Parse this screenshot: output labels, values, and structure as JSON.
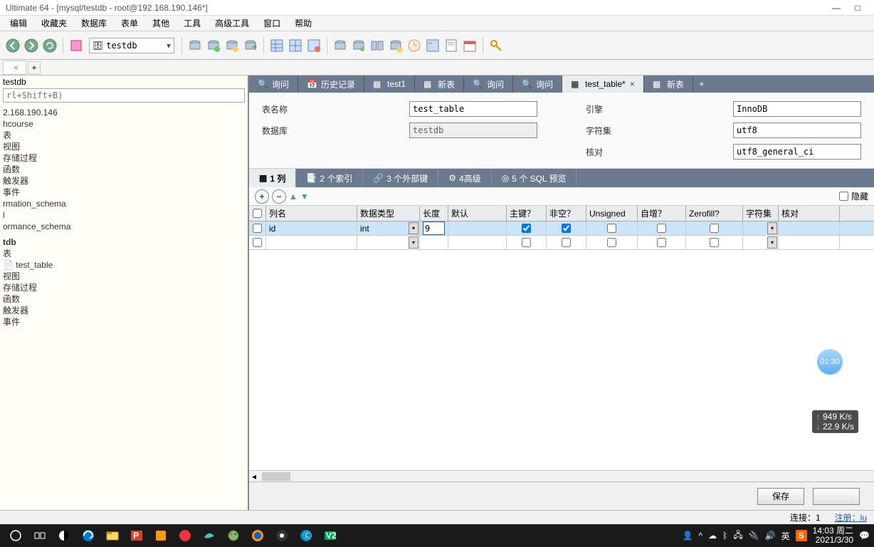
{
  "window": {
    "title": "Ultimate 64 - [mysql/testdb - root@192.168.190.146*]"
  },
  "menu": [
    "编辑",
    "收藏夹",
    "数据库",
    "表单",
    "其他",
    "工具",
    "高级工具",
    "窗口",
    "帮助"
  ],
  "conn_tab": {
    "label": "",
    "close": "×",
    "add": "+"
  },
  "db_selector": "testdb",
  "sidebar": {
    "root": "testdb",
    "filter_placeholder": "rl+Shift+B)",
    "nodes": [
      "2.168.190.146",
      "hcourse",
      "表",
      "视图",
      "存储过程",
      "函数",
      "触发器",
      "事件",
      "rmation_schema",
      "l",
      "ormance_schema"
    ],
    "db": "tdb",
    "db_children": [
      "表",
      "  📄 test_table",
      "视图",
      "存储过程",
      "函数",
      "触发器",
      "事件"
    ]
  },
  "inner_tabs": [
    {
      "label": "询问",
      "icon": "query"
    },
    {
      "label": "历史记录",
      "icon": "history"
    },
    {
      "label": "test1",
      "icon": "table"
    },
    {
      "label": "新表",
      "icon": "table"
    },
    {
      "label": "询问",
      "icon": "query"
    },
    {
      "label": "询问",
      "icon": "query"
    },
    {
      "label": "test_table*",
      "icon": "table",
      "active": true,
      "close": "×"
    },
    {
      "label": "新表",
      "icon": "table"
    }
  ],
  "form": {
    "name_label": "表名称",
    "name_value": "test_table",
    "db_label": "数据库",
    "db_value": "testdb",
    "engine_label": "引擎",
    "engine_value": "InnoDB",
    "charset_label": "字符集",
    "charset_value": "utf8",
    "collation_label": "核对",
    "collation_value": "utf8_general_ci"
  },
  "subtabs": [
    {
      "label": "1 列",
      "icon": "cols",
      "active": true
    },
    {
      "label": "2 个索引",
      "icon": "index"
    },
    {
      "label": "3 个外部键",
      "icon": "fk"
    },
    {
      "label": "4高级",
      "icon": "adv"
    },
    {
      "label": "5 个 SQL 预览",
      "icon": "sql"
    }
  ],
  "hide_label": "隐藏",
  "cols_header": [
    "",
    "列名",
    "数据类型",
    "长度",
    "默认",
    "主键？",
    "非空？",
    "Unsigned",
    "自增？",
    "Zerofill?",
    "字符集",
    "核对"
  ],
  "rows": [
    {
      "name": "id",
      "type": "int",
      "len": "9",
      "pk": true,
      "nn": true,
      "un": false,
      "ai": false,
      "zf": false
    }
  ],
  "footer": {
    "save": "保存"
  },
  "status": {
    "conn": "连接：1",
    "reg": "注册：lu"
  },
  "taskbar": {
    "clock": "14:03 周二",
    "date": "2021/3/30"
  },
  "overlay": {
    "bubble": "01:30",
    "net_up": "949 K/s",
    "net_dn": "22.9 K/s"
  },
  "tray_ime": "英",
  "tray_sogou": "S"
}
